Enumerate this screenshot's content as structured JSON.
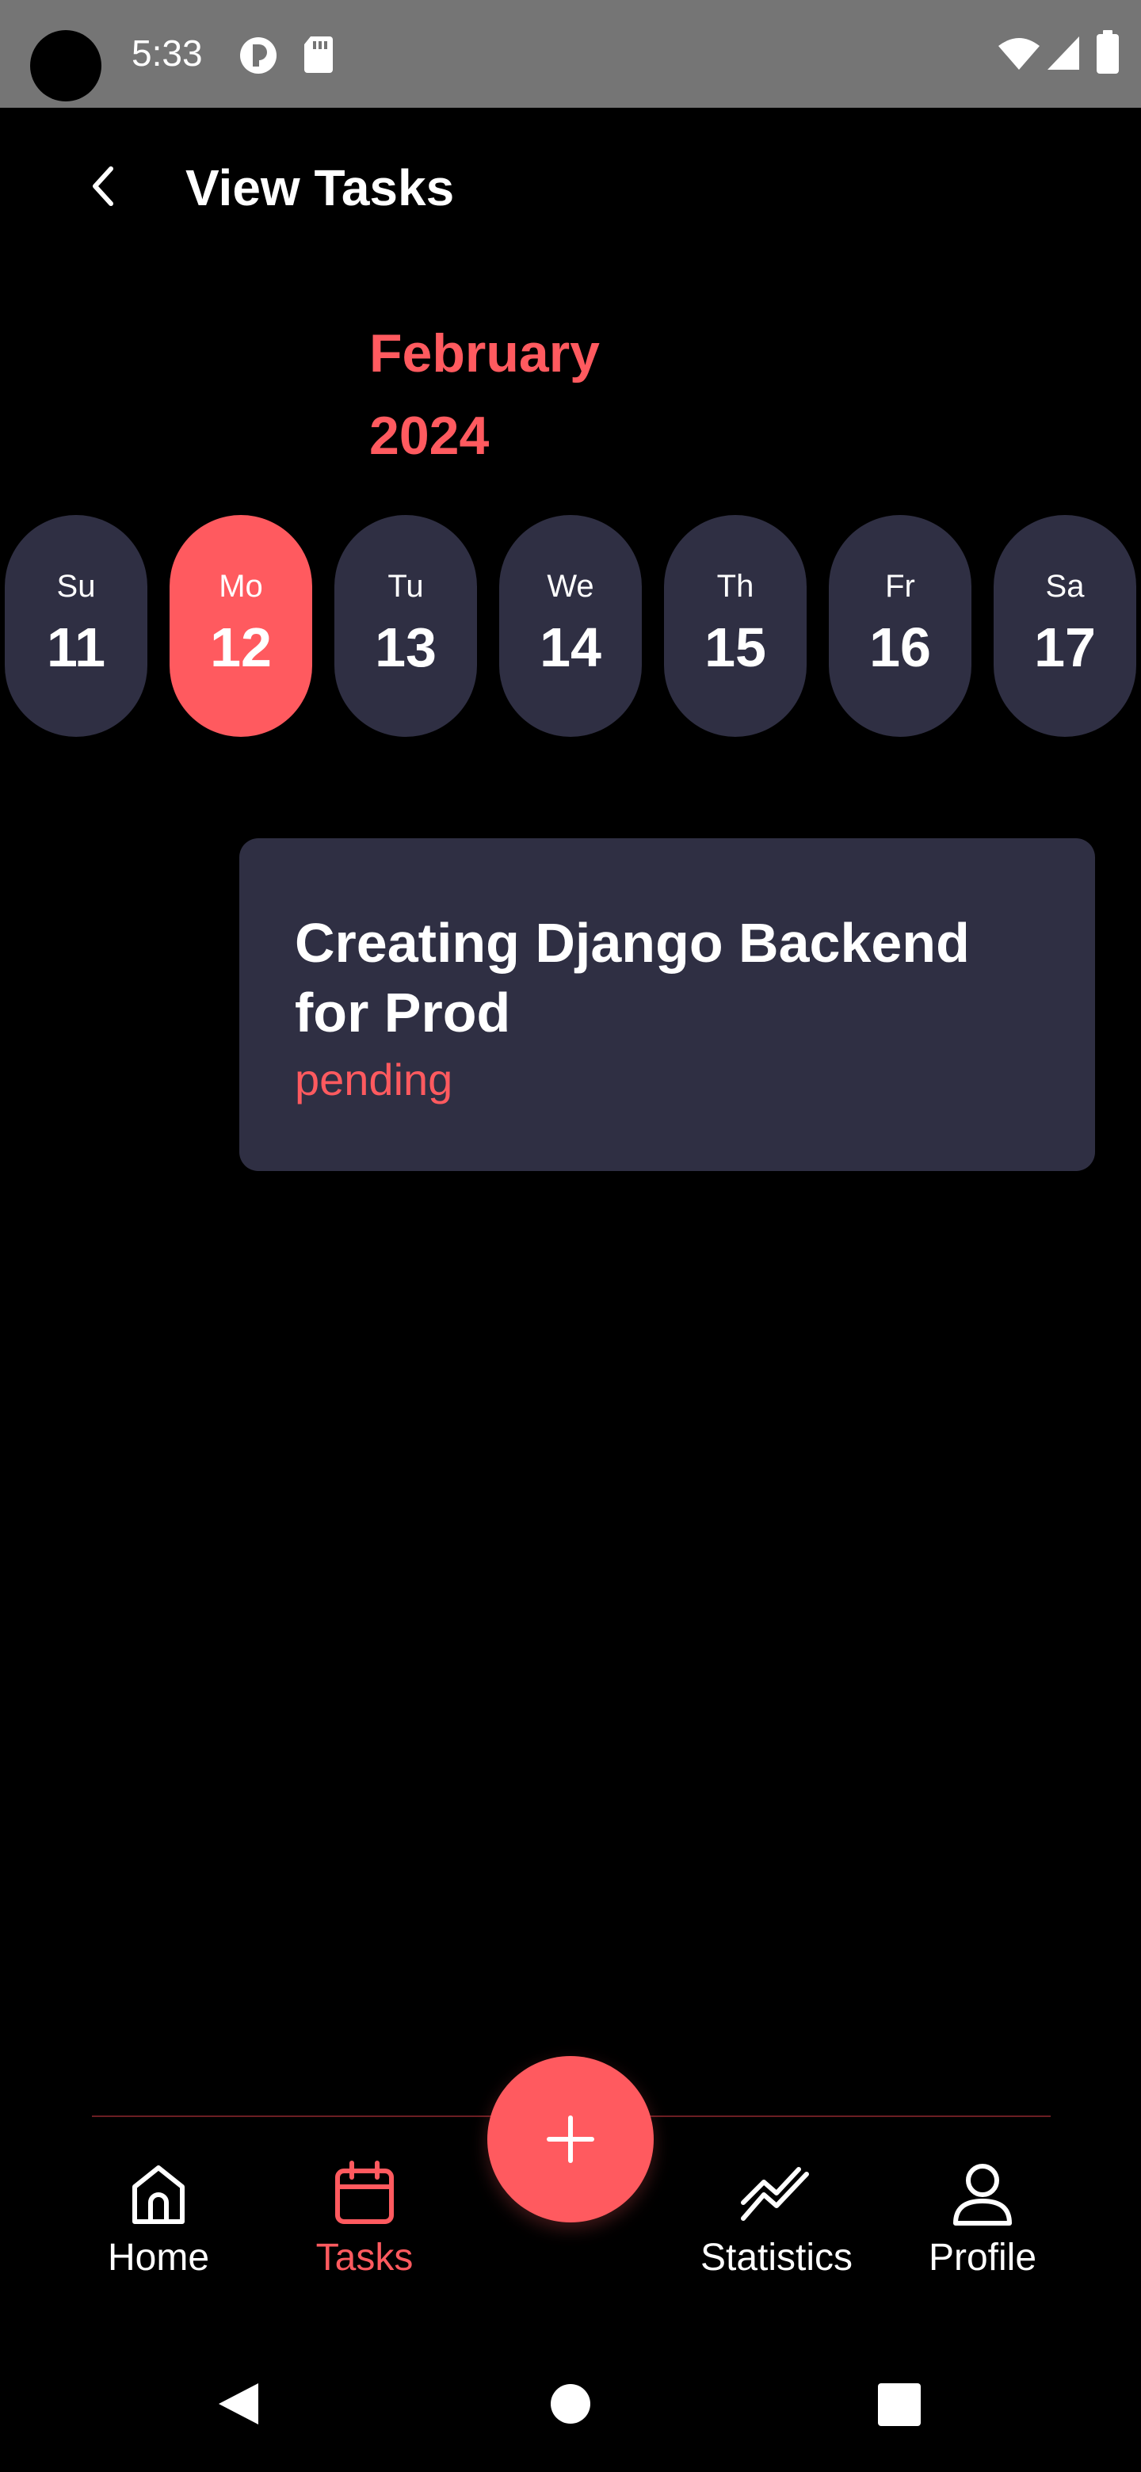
{
  "status_bar": {
    "time": "5:33"
  },
  "header": {
    "title": "View Tasks"
  },
  "calendar": {
    "month": "February",
    "year": "2024",
    "selected_day": "12",
    "days": [
      {
        "name": "Su",
        "num": "11"
      },
      {
        "name": "Mo",
        "num": "12"
      },
      {
        "name": "Tu",
        "num": "13"
      },
      {
        "name": "We",
        "num": "14"
      },
      {
        "name": "Th",
        "num": "15"
      },
      {
        "name": "Fr",
        "num": "16"
      },
      {
        "name": "Sa",
        "num": "17"
      }
    ]
  },
  "tasks": [
    {
      "title": "Creating Django Backend for Prod",
      "status": "pending"
    }
  ],
  "bottom_nav": {
    "items": [
      {
        "label": "Home",
        "icon": "home-icon"
      },
      {
        "label": "Tasks",
        "icon": "calendar-icon"
      },
      {
        "label": "Statistics",
        "icon": "chart-line-icon"
      },
      {
        "label": "Profile",
        "icon": "person-icon"
      }
    ],
    "active": "Tasks",
    "fab_icon": "plus-icon"
  },
  "colors": {
    "accent": "#FF5A5F",
    "surface": "#2F2F43",
    "background": "#000000",
    "status_bar": "#757575"
  }
}
